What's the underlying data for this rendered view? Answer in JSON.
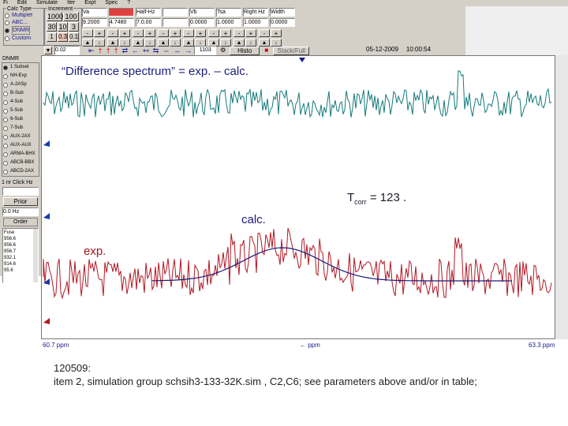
{
  "menu": {
    "items": [
      "Fi",
      "Edit",
      "Simulate",
      "Iter",
      "Expt",
      "Spec",
      "?"
    ]
  },
  "toolbar": {
    "calc_type_label": "Calc Type",
    "calc_types": [
      "Multiplet",
      "ABC...",
      "DNMR",
      "Custom"
    ],
    "selected_calc_type": 2,
    "increment_label": "Increment",
    "increments": [
      [
        "1000",
        "100"
      ],
      [
        "30",
        "10",
        "3"
      ],
      [
        "1",
        "0.3",
        "0.1"
      ]
    ],
    "value_field": "0.02",
    "params": [
      {
        "label": "Va",
        "value": "9.2000"
      },
      {
        "label": "",
        "value": "4.7480"
      },
      {
        "label": "Half-Hz",
        "value": "7.0.00"
      },
      {
        "label": "",
        "value": ""
      },
      {
        "label": "Vb",
        "value": "0.0000"
      },
      {
        "label": "Tsa",
        "value": "1.0000"
      },
      {
        "label": "Right Hz",
        "value": "1.0000"
      },
      {
        "label": "Width",
        "value": "0.0000"
      }
    ],
    "points_field": "1103",
    "histo_label": "Histo",
    "stack_label": "Stack/Full",
    "date": "05-12-2009",
    "time": "10:00:54"
  },
  "sidebar": {
    "title": "DNMR",
    "items": [
      "1 Subset",
      "NH-Exp",
      "A-2ASp",
      "B-Sub",
      "4-Sub",
      "5-Sub",
      "6-Sub",
      "7-Sub",
      "AUX-2AX",
      "AUX-AUX",
      "ARMA-BHX",
      "ABCB-BBX",
      "ABCD-2AX"
    ],
    "selected": 0,
    "field_label": "1 nr Click Hz",
    "field_value": "",
    "order_label": "Order",
    "list_label": "Order",
    "list_values": [
      "Fuse",
      "956.6",
      "956.6",
      "956.7",
      "932.1",
      "914.6",
      "95.6"
    ],
    "bottom_value": "0.0 Hz"
  },
  "spectrum": {
    "title_annotation": "“Difference spectrum” = exp. – calc.",
    "tcorr_label": "T",
    "tcorr_sub": "corr",
    "tcorr_value": " = 123 .",
    "calc_label": "calc.",
    "exp_label": "exp.",
    "ppm_left": "60.7 ppm",
    "ppm_center": "← ppm",
    "ppm_right": "63.3 ppm",
    "colors": {
      "diff": "#157a7a",
      "exp": "#b01824",
      "calc": "#1a1a78"
    }
  },
  "caption": {
    "line1": "120509:",
    "line2": "item 2, simulation group schsih3-133-32K.sim ,  C2,C6; see parameters above and/or in table;"
  }
}
